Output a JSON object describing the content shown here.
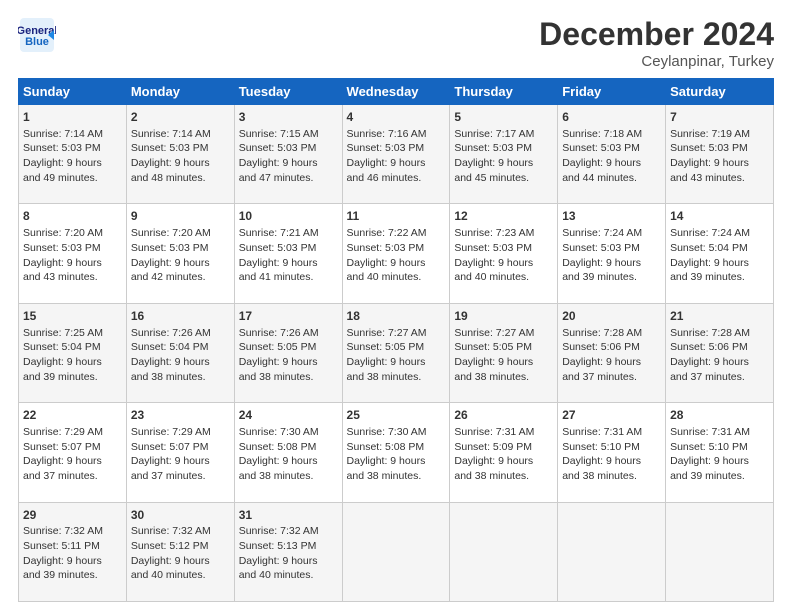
{
  "logo": {
    "line1": "General",
    "line2": "Blue"
  },
  "title": "December 2024",
  "subtitle": "Ceylanpinar, Turkey",
  "days_of_week": [
    "Sunday",
    "Monday",
    "Tuesday",
    "Wednesday",
    "Thursday",
    "Friday",
    "Saturday"
  ],
  "weeks": [
    [
      {
        "day": "1",
        "lines": [
          "Sunrise: 7:14 AM",
          "Sunset: 5:03 PM",
          "Daylight: 9 hours",
          "and 49 minutes."
        ]
      },
      {
        "day": "2",
        "lines": [
          "Sunrise: 7:14 AM",
          "Sunset: 5:03 PM",
          "Daylight: 9 hours",
          "and 48 minutes."
        ]
      },
      {
        "day": "3",
        "lines": [
          "Sunrise: 7:15 AM",
          "Sunset: 5:03 PM",
          "Daylight: 9 hours",
          "and 47 minutes."
        ]
      },
      {
        "day": "4",
        "lines": [
          "Sunrise: 7:16 AM",
          "Sunset: 5:03 PM",
          "Daylight: 9 hours",
          "and 46 minutes."
        ]
      },
      {
        "day": "5",
        "lines": [
          "Sunrise: 7:17 AM",
          "Sunset: 5:03 PM",
          "Daylight: 9 hours",
          "and 45 minutes."
        ]
      },
      {
        "day": "6",
        "lines": [
          "Sunrise: 7:18 AM",
          "Sunset: 5:03 PM",
          "Daylight: 9 hours",
          "and 44 minutes."
        ]
      },
      {
        "day": "7",
        "lines": [
          "Sunrise: 7:19 AM",
          "Sunset: 5:03 PM",
          "Daylight: 9 hours",
          "and 43 minutes."
        ]
      }
    ],
    [
      {
        "day": "8",
        "lines": [
          "Sunrise: 7:20 AM",
          "Sunset: 5:03 PM",
          "Daylight: 9 hours",
          "and 43 minutes."
        ]
      },
      {
        "day": "9",
        "lines": [
          "Sunrise: 7:20 AM",
          "Sunset: 5:03 PM",
          "Daylight: 9 hours",
          "and 42 minutes."
        ]
      },
      {
        "day": "10",
        "lines": [
          "Sunrise: 7:21 AM",
          "Sunset: 5:03 PM",
          "Daylight: 9 hours",
          "and 41 minutes."
        ]
      },
      {
        "day": "11",
        "lines": [
          "Sunrise: 7:22 AM",
          "Sunset: 5:03 PM",
          "Daylight: 9 hours",
          "and 40 minutes."
        ]
      },
      {
        "day": "12",
        "lines": [
          "Sunrise: 7:23 AM",
          "Sunset: 5:03 PM",
          "Daylight: 9 hours",
          "and 40 minutes."
        ]
      },
      {
        "day": "13",
        "lines": [
          "Sunrise: 7:24 AM",
          "Sunset: 5:03 PM",
          "Daylight: 9 hours",
          "and 39 minutes."
        ]
      },
      {
        "day": "14",
        "lines": [
          "Sunrise: 7:24 AM",
          "Sunset: 5:04 PM",
          "Daylight: 9 hours",
          "and 39 minutes."
        ]
      }
    ],
    [
      {
        "day": "15",
        "lines": [
          "Sunrise: 7:25 AM",
          "Sunset: 5:04 PM",
          "Daylight: 9 hours",
          "and 39 minutes."
        ]
      },
      {
        "day": "16",
        "lines": [
          "Sunrise: 7:26 AM",
          "Sunset: 5:04 PM",
          "Daylight: 9 hours",
          "and 38 minutes."
        ]
      },
      {
        "day": "17",
        "lines": [
          "Sunrise: 7:26 AM",
          "Sunset: 5:05 PM",
          "Daylight: 9 hours",
          "and 38 minutes."
        ]
      },
      {
        "day": "18",
        "lines": [
          "Sunrise: 7:27 AM",
          "Sunset: 5:05 PM",
          "Daylight: 9 hours",
          "and 38 minutes."
        ]
      },
      {
        "day": "19",
        "lines": [
          "Sunrise: 7:27 AM",
          "Sunset: 5:05 PM",
          "Daylight: 9 hours",
          "and 38 minutes."
        ]
      },
      {
        "day": "20",
        "lines": [
          "Sunrise: 7:28 AM",
          "Sunset: 5:06 PM",
          "Daylight: 9 hours",
          "and 37 minutes."
        ]
      },
      {
        "day": "21",
        "lines": [
          "Sunrise: 7:28 AM",
          "Sunset: 5:06 PM",
          "Daylight: 9 hours",
          "and 37 minutes."
        ]
      }
    ],
    [
      {
        "day": "22",
        "lines": [
          "Sunrise: 7:29 AM",
          "Sunset: 5:07 PM",
          "Daylight: 9 hours",
          "and 37 minutes."
        ]
      },
      {
        "day": "23",
        "lines": [
          "Sunrise: 7:29 AM",
          "Sunset: 5:07 PM",
          "Daylight: 9 hours",
          "and 37 minutes."
        ]
      },
      {
        "day": "24",
        "lines": [
          "Sunrise: 7:30 AM",
          "Sunset: 5:08 PM",
          "Daylight: 9 hours",
          "and 38 minutes."
        ]
      },
      {
        "day": "25",
        "lines": [
          "Sunrise: 7:30 AM",
          "Sunset: 5:08 PM",
          "Daylight: 9 hours",
          "and 38 minutes."
        ]
      },
      {
        "day": "26",
        "lines": [
          "Sunrise: 7:31 AM",
          "Sunset: 5:09 PM",
          "Daylight: 9 hours",
          "and 38 minutes."
        ]
      },
      {
        "day": "27",
        "lines": [
          "Sunrise: 7:31 AM",
          "Sunset: 5:10 PM",
          "Daylight: 9 hours",
          "and 38 minutes."
        ]
      },
      {
        "day": "28",
        "lines": [
          "Sunrise: 7:31 AM",
          "Sunset: 5:10 PM",
          "Daylight: 9 hours",
          "and 39 minutes."
        ]
      }
    ],
    [
      {
        "day": "29",
        "lines": [
          "Sunrise: 7:32 AM",
          "Sunset: 5:11 PM",
          "Daylight: 9 hours",
          "and 39 minutes."
        ]
      },
      {
        "day": "30",
        "lines": [
          "Sunrise: 7:32 AM",
          "Sunset: 5:12 PM",
          "Daylight: 9 hours",
          "and 40 minutes."
        ]
      },
      {
        "day": "31",
        "lines": [
          "Sunrise: 7:32 AM",
          "Sunset: 5:13 PM",
          "Daylight: 9 hours",
          "and 40 minutes."
        ]
      },
      null,
      null,
      null,
      null
    ]
  ]
}
